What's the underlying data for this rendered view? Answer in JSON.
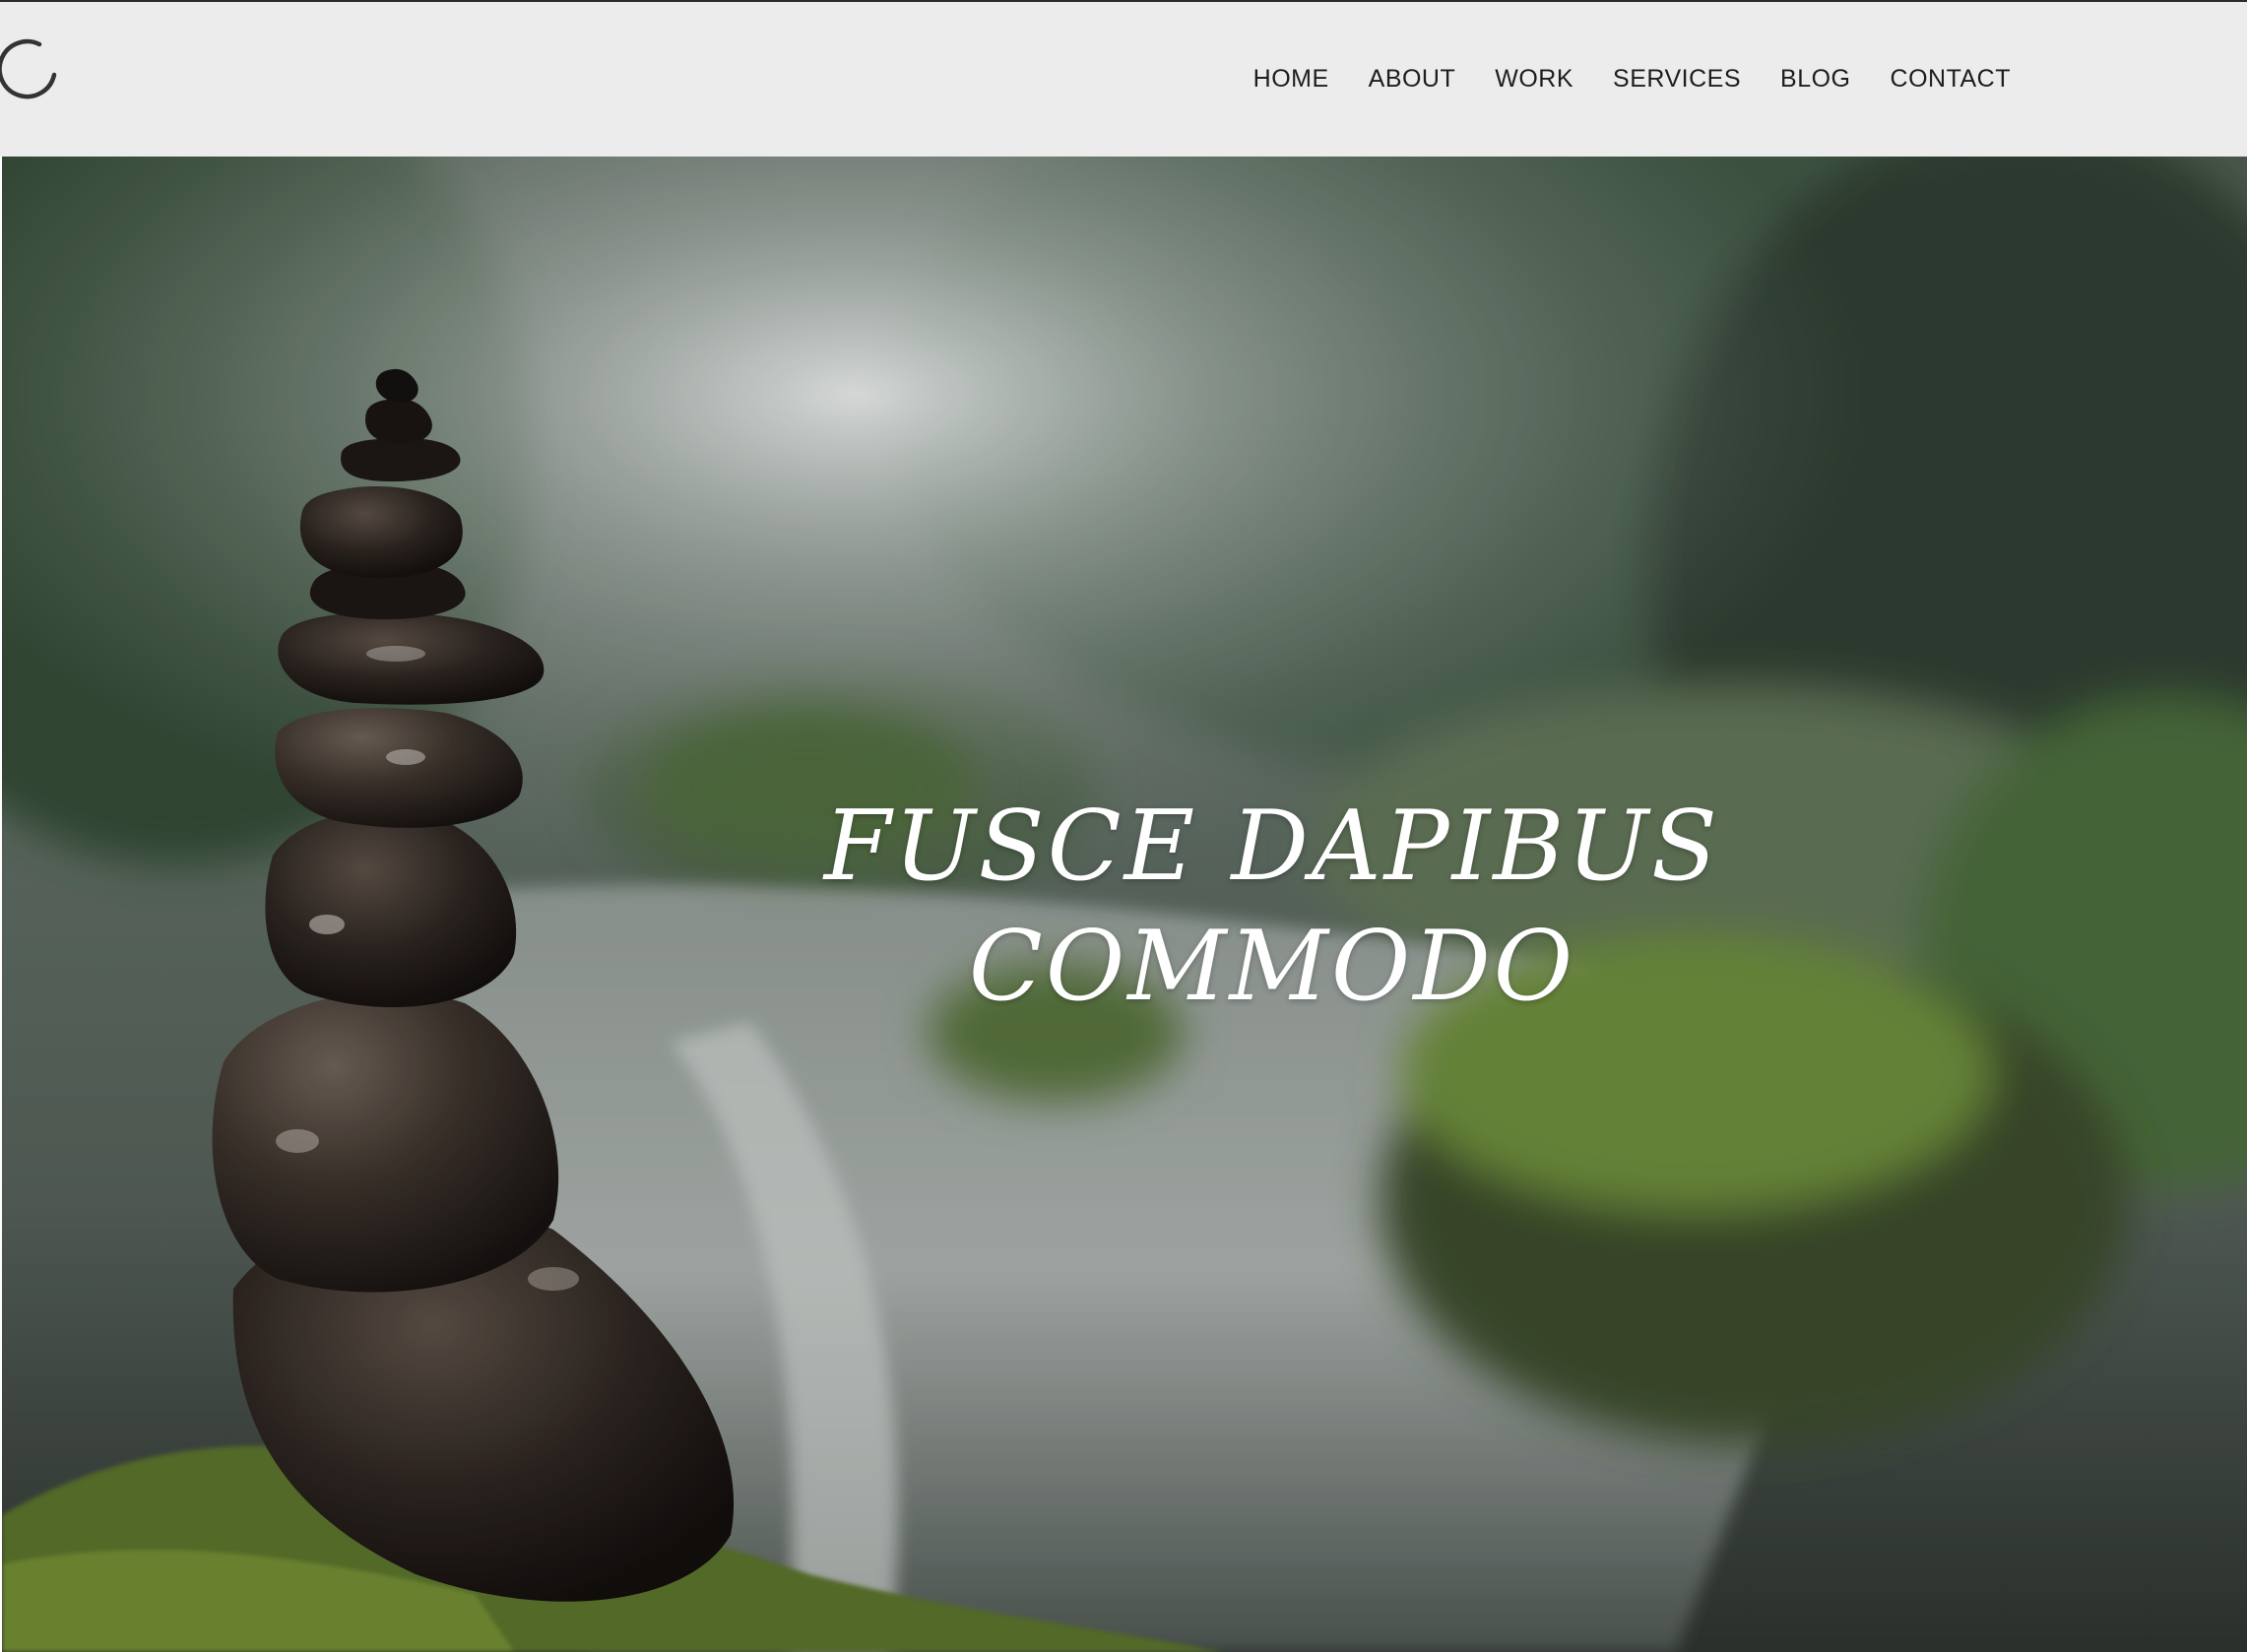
{
  "nav": {
    "items": [
      {
        "label": "HOME"
      },
      {
        "label": "ABOUT"
      },
      {
        "label": "WORK"
      },
      {
        "label": "SERVICES"
      },
      {
        "label": "BLOG"
      },
      {
        "label": "CONTACT"
      }
    ]
  },
  "hero": {
    "title_line1": "FUSCE DAPIBUS",
    "title_line2": "COMMODO"
  },
  "icons": {
    "logo": "loading-spinner-icon"
  },
  "colors": {
    "header_bg": "#ececec",
    "nav_text": "#1d1d1d",
    "hero_title": "#ffffff"
  }
}
